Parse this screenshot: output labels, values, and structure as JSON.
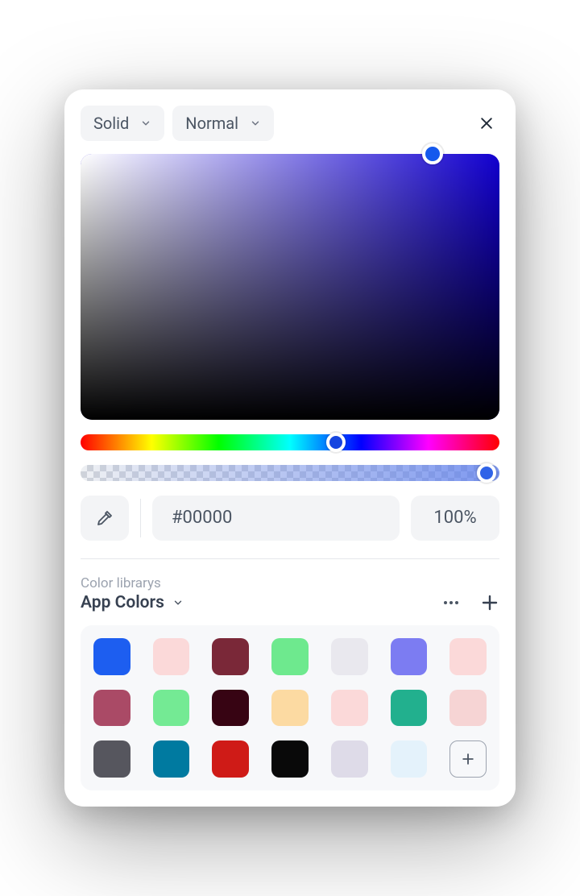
{
  "top": {
    "fill_type_label": "Solid",
    "blend_mode_label": "Normal"
  },
  "hex_value": "#00000",
  "opacity_value": "100%",
  "library": {
    "section_label": "Color librarys",
    "current_name": "App Colors"
  },
  "swatches": [
    "#1d5ef0",
    "#fbd9d9",
    "#7a2838",
    "#6ee98e",
    "#e9e8ee",
    "#7c7cf2",
    "#fbd9d9",
    "#aa4a66",
    "#74ea94",
    "#370413",
    "#fcdaa2",
    "#fbd9d9",
    "#22b08e",
    "#f6d4d4",
    "#56565e",
    "#007aa0",
    "#cf1b17",
    "#090909",
    "#dedbe8",
    "#e4f2fb"
  ]
}
